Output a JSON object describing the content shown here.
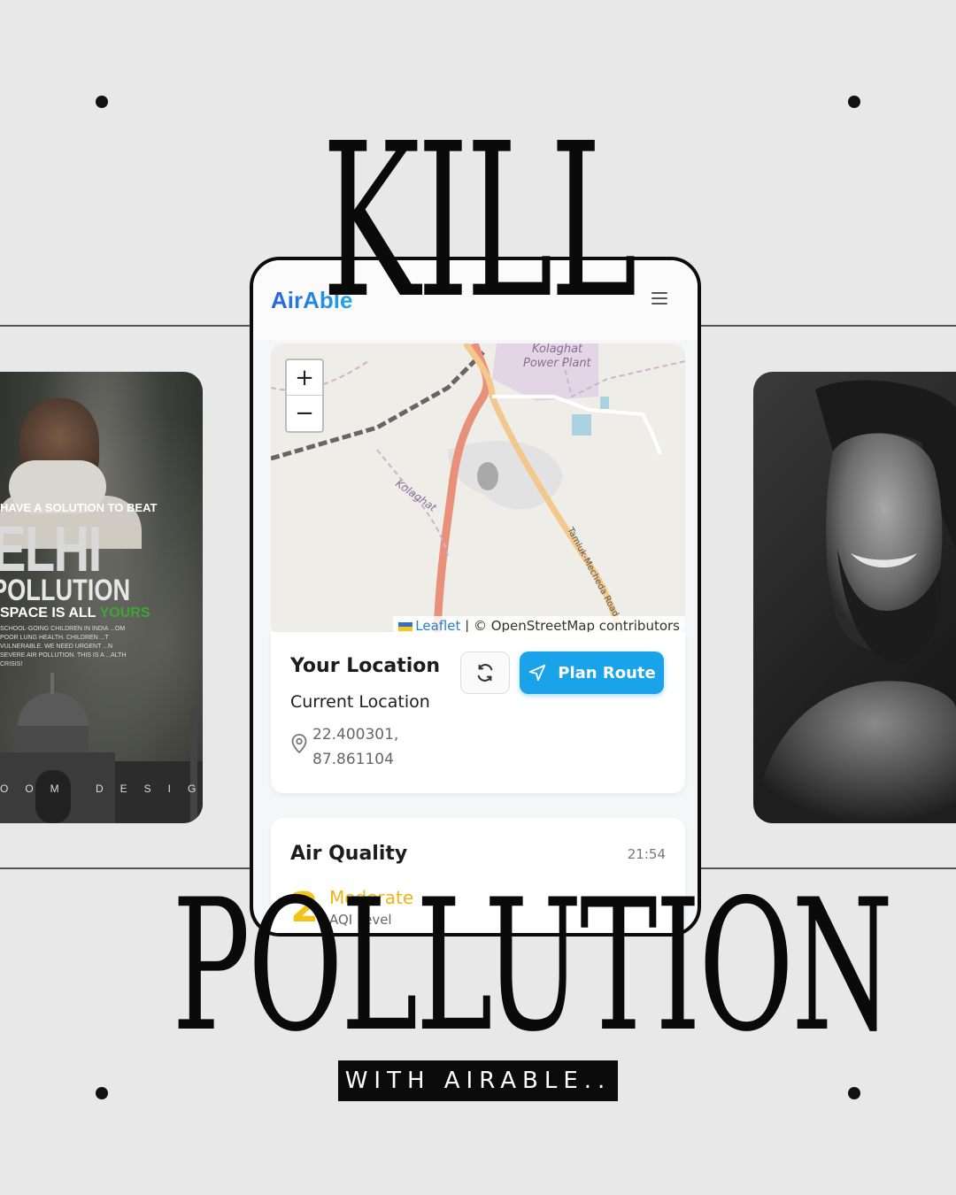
{
  "poster": {
    "headline_top": "KILL",
    "headline_bottom": "POLLUTION",
    "tagline": "WITH AIRABLE.."
  },
  "left_poster": {
    "line1": "HAVE A SOLUTION TO BEAT",
    "line2": "ELHI",
    "line3": "POLLUTION",
    "line4_a": "SPACE IS ALL ",
    "line4_b": "YOURS",
    "body": "SCHOOL-GOING CHILDREN IN INDIA ...OM POOR LUNG HEALTH. CHILDREN ...T VULNERABLE. WE NEED URGENT ...N SEVERE AIR POLLUTION. THIS IS A ...ALTH CRISIS!",
    "footer": "OOM DESIGN"
  },
  "app": {
    "logo": "AirAble",
    "menu_icon": "hamburger-menu-icon",
    "map": {
      "zoom_in": "+",
      "zoom_out": "−",
      "attribution_link": "Leaflet",
      "attribution_text": " | © OpenStreetMap contributors",
      "label_plant_1": "Kolaghat",
      "label_plant_2": "Power Plant",
      "label_town": "Kolaghat",
      "label_road": "Tamluk-Mecheda Road"
    },
    "location": {
      "title": "Your Location",
      "subtitle": "Current Location",
      "lat": "22.400301,",
      "lng": "87.861104",
      "refresh_icon": "refresh-icon",
      "plan_route_label": "Plan Route",
      "plan_route_icon": "navigation-arrow-icon"
    },
    "air_quality": {
      "title": "Air Quality",
      "time": "21:54",
      "aqi_value": "2",
      "aqi_category": "Moderate",
      "aqi_caption": "AQI Level"
    }
  },
  "colors": {
    "background": "#e8e8e8",
    "accent_blue": "#1aa3e8",
    "aqi_yellow": "#f2c416"
  }
}
